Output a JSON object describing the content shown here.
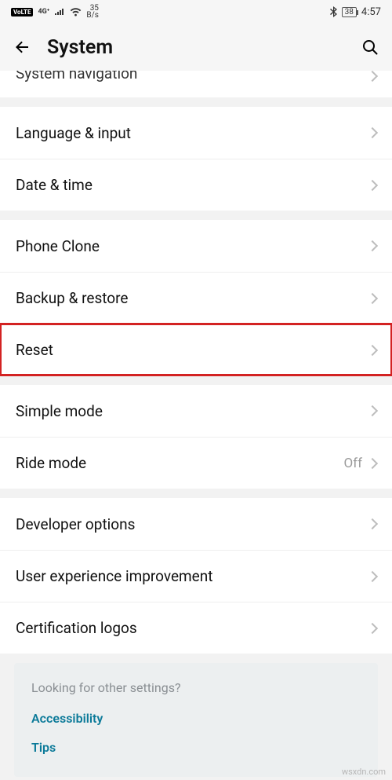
{
  "status": {
    "volte": "VoLTE",
    "net_label": "4G⁺",
    "speed_top": "35",
    "speed_bottom": "B/s",
    "battery": "38",
    "time": "4:57"
  },
  "header": {
    "title": "System"
  },
  "groups": [
    {
      "rows": [
        {
          "label": "System navigation",
          "value": "",
          "highlight": false,
          "partial_top": true
        }
      ]
    },
    {
      "rows": [
        {
          "label": "Language & input",
          "value": "",
          "highlight": false
        },
        {
          "label": "Date & time",
          "value": "",
          "highlight": false
        }
      ]
    },
    {
      "rows": [
        {
          "label": "Phone Clone",
          "value": "",
          "highlight": false
        },
        {
          "label": "Backup & restore",
          "value": "",
          "highlight": false
        },
        {
          "label": "Reset",
          "value": "",
          "highlight": true
        }
      ]
    },
    {
      "rows": [
        {
          "label": "Simple mode",
          "value": "",
          "highlight": false
        },
        {
          "label": "Ride mode",
          "value": "Off",
          "highlight": false
        }
      ]
    },
    {
      "rows": [
        {
          "label": "Developer options",
          "value": "",
          "highlight": false
        },
        {
          "label": "User experience improvement",
          "value": "",
          "highlight": false
        },
        {
          "label": "Certification logos",
          "value": "",
          "highlight": false
        }
      ]
    }
  ],
  "other": {
    "title": "Looking for other settings?",
    "links": [
      "Accessibility",
      "Tips"
    ]
  },
  "watermark": "wsxdn.com"
}
